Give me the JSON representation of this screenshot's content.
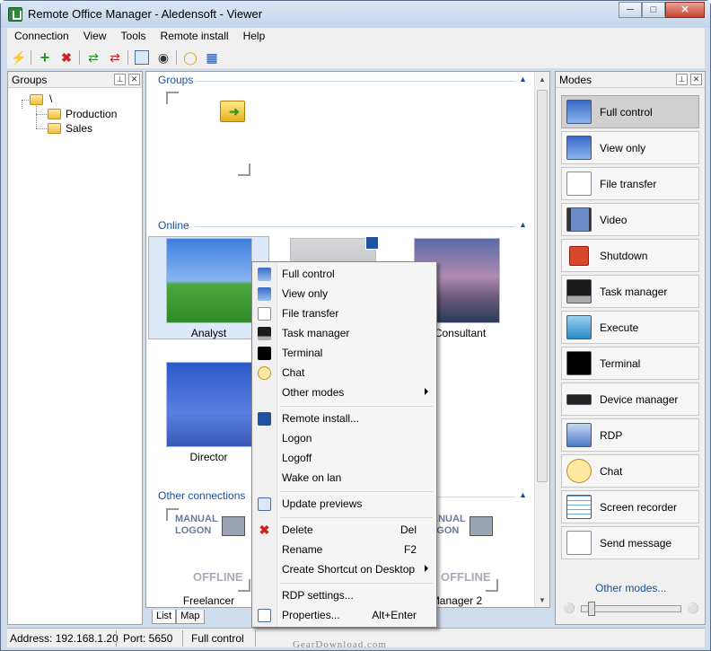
{
  "window": {
    "title": "Remote Office Manager - Aledensoft - Viewer"
  },
  "menubar": [
    "Connection",
    "View",
    "Tools",
    "Remote install",
    "Help"
  ],
  "groups_panel": {
    "title": "Groups",
    "tree": {
      "root": "\\",
      "children": [
        "Production",
        "Sales"
      ]
    }
  },
  "main": {
    "sections": {
      "groups": "Groups",
      "online": "Online",
      "other": "Other connections"
    },
    "online_computers": [
      {
        "label": "Analyst",
        "selected": true
      },
      {
        "label": ""
      },
      {
        "label": "Consultant"
      },
      {
        "label": "Director"
      }
    ],
    "other_computers": [
      {
        "label": "Freelancer",
        "line1": "MANUAL",
        "line2": "LOGON",
        "status": "OFFLINE"
      },
      {
        "label": "Manager 2",
        "line1": "MANUAL",
        "line2": "LOGON",
        "status": "OFFLINE"
      }
    ],
    "tabs": [
      "List",
      "Map"
    ]
  },
  "modes_panel": {
    "title": "Modes",
    "items": [
      "Full control",
      "View only",
      "File transfer",
      "Video",
      "Shutdown",
      "Task manager",
      "Execute",
      "Terminal",
      "Device manager",
      "RDP",
      "Chat",
      "Screen recorder",
      "Send message"
    ],
    "active": "Full control",
    "other_link": "Other modes..."
  },
  "context_menu": {
    "items": [
      {
        "label": "Full control",
        "icon": "full-control-icon"
      },
      {
        "label": "View only",
        "icon": "view-only-icon"
      },
      {
        "label": "File transfer",
        "icon": "file-transfer-icon"
      },
      {
        "label": "Task manager",
        "icon": "task-manager-icon"
      },
      {
        "label": "Terminal",
        "icon": "terminal-icon"
      },
      {
        "label": "Chat",
        "icon": "chat-icon"
      },
      {
        "label": "Other modes",
        "submenu": true
      },
      {
        "label": "Remote install...",
        "icon": "remote-install-icon"
      },
      {
        "label": "Logon"
      },
      {
        "label": "Logoff"
      },
      {
        "label": "Wake on lan"
      },
      {
        "label": "Update previews",
        "icon": "update-previews-icon"
      },
      {
        "label": "Delete",
        "icon": "delete-icon",
        "shortcut": "Del"
      },
      {
        "label": "Rename",
        "shortcut": "F2"
      },
      {
        "label": "Create Shortcut on Desktop",
        "submenu": true
      },
      {
        "label": "RDP settings..."
      },
      {
        "label": "Properties...",
        "icon": "properties-icon",
        "shortcut": "Alt+Enter"
      }
    ]
  },
  "statusbar": {
    "address": "Address: 192.168.1.20",
    "port": "Port: 5650",
    "mode": "Full control"
  },
  "watermark": "GearDownload.com"
}
